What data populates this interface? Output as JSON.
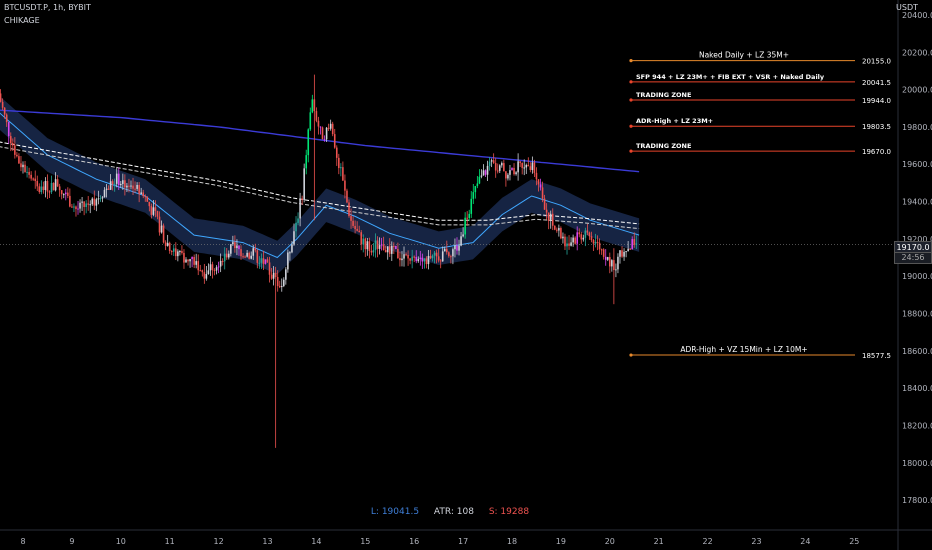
{
  "header": {
    "symbol": "BTCUSDT.P, 1h, BYBIT",
    "author": "CHIKAGE",
    "currency": "USDT"
  },
  "last_price": "19170.0",
  "countdown": "24:56",
  "stats": {
    "low_label": "L: 19041.5",
    "atr_label": "ATR: 108",
    "short_label": "S: 19288"
  },
  "colors": {
    "background": "#000000",
    "level_line": "#e8442b",
    "level_line_orange": "#e6892c",
    "sma_purple": "#3b3bd6",
    "band_fill": "#1a2a4f",
    "band_mid": "#3fa7ff",
    "bull": "#26a69a",
    "bear": "#ef5350",
    "neutral": "#d1d4dc",
    "magenta": "#d946ef",
    "green_bright": "#00e676"
  },
  "chart_data": {
    "type": "candlestick",
    "xlabels": [
      "8",
      "9",
      "10",
      "11",
      "12",
      "13",
      "14",
      "15",
      "16",
      "17",
      "18",
      "19",
      "20",
      "21",
      "22",
      "23",
      "24",
      "25"
    ],
    "y_ticks": [
      17800,
      18000,
      18200,
      18400,
      18600,
      18800,
      19000,
      19200,
      19400,
      19600,
      19800,
      20000,
      20200,
      20400
    ],
    "y_tick_labels": [
      "17800.0",
      "18000.0",
      "18200.0",
      "18400.0",
      "18600.0",
      "18800.0",
      "19000.0",
      "19200.0",
      "19400.0",
      "19600.0",
      "19800.0",
      "20000.0",
      "20200.0",
      "20400.0"
    ],
    "ylim": [
      17640,
      20480
    ],
    "xlim_days": [
      7.5,
      26.0
    ],
    "levels": [
      {
        "label": "Naked Daily + LZ 35M+",
        "value": 20155.0,
        "value_label": "20155.0",
        "color": "orange",
        "label_align": "center"
      },
      {
        "label": "SFP 944 + LZ 23M+ + FIB EXT + VSR + Naked Daily",
        "value": 20041.5,
        "value_label": "20041.5",
        "color": "red",
        "label_align": "left"
      },
      {
        "label": "TRADING ZONE",
        "value": 19944.0,
        "value_label": "19944.0",
        "color": "red",
        "label_align": "left"
      },
      {
        "label": "ADR-High + LZ 23M+",
        "value": 19803.5,
        "value_label": "19803.5",
        "color": "red",
        "label_align": "left"
      },
      {
        "label": "TRADING ZONE",
        "value": 19670.0,
        "value_label": "19670.0",
        "color": "red",
        "label_align": "left"
      },
      {
        "label": "ADR-High + VZ 15Min + LZ 10M+",
        "value": 18577.5,
        "value_label": "18577.5",
        "color": "orange",
        "label_align": "center"
      }
    ],
    "price_path": [
      [
        7.5,
        19980
      ],
      [
        7.7,
        19780
      ],
      [
        7.9,
        19620
      ],
      [
        8.1,
        19560
      ],
      [
        8.3,
        19460
      ],
      [
        8.5,
        19480
      ],
      [
        8.7,
        19500
      ],
      [
        8.9,
        19420
      ],
      [
        9.1,
        19360
      ],
      [
        9.3,
        19380
      ],
      [
        9.5,
        19420
      ],
      [
        9.7,
        19470
      ],
      [
        9.9,
        19520
      ],
      [
        10.1,
        19500
      ],
      [
        10.3,
        19470
      ],
      [
        10.5,
        19420
      ],
      [
        10.7,
        19320
      ],
      [
        10.9,
        19200
      ],
      [
        11.1,
        19120
      ],
      [
        11.3,
        19100
      ],
      [
        11.5,
        19080
      ],
      [
        11.7,
        19020
      ],
      [
        11.9,
        19060
      ],
      [
        12.1,
        19110
      ],
      [
        12.3,
        19150
      ],
      [
        12.5,
        19130
      ],
      [
        12.7,
        19120
      ],
      [
        12.9,
        19080
      ],
      [
        13.1,
        19000
      ],
      [
        13.3,
        18950
      ],
      [
        13.5,
        19200
      ],
      [
        13.7,
        19420
      ],
      [
        13.9,
        19950
      ],
      [
        14.1,
        19750
      ],
      [
        14.3,
        19800
      ],
      [
        14.5,
        19550
      ],
      [
        14.7,
        19300
      ],
      [
        14.9,
        19200
      ],
      [
        15.1,
        19150
      ],
      [
        15.3,
        19170
      ],
      [
        15.5,
        19140
      ],
      [
        15.7,
        19110
      ],
      [
        15.9,
        19090
      ],
      [
        16.1,
        19120
      ],
      [
        16.3,
        19080
      ],
      [
        16.5,
        19110
      ],
      [
        16.7,
        19130
      ],
      [
        16.9,
        19160
      ],
      [
        17.1,
        19350
      ],
      [
        17.3,
        19500
      ],
      [
        17.5,
        19580
      ],
      [
        17.7,
        19600
      ],
      [
        17.9,
        19550
      ],
      [
        18.1,
        19580
      ],
      [
        18.3,
        19620
      ],
      [
        18.5,
        19550
      ],
      [
        18.7,
        19350
      ],
      [
        18.9,
        19250
      ],
      [
        19.1,
        19180
      ],
      [
        19.3,
        19200
      ],
      [
        19.5,
        19240
      ],
      [
        19.7,
        19180
      ],
      [
        19.9,
        19120
      ],
      [
        20.1,
        19050
      ],
      [
        20.3,
        19150
      ],
      [
        20.5,
        19170
      ]
    ],
    "spikes": [
      {
        "day": 13.15,
        "low": 18080,
        "high": 19050
      },
      {
        "day": 13.95,
        "low": 19300,
        "high": 20080
      },
      {
        "day": 20.1,
        "low": 18850,
        "high": 19150
      }
    ],
    "sma_long": [
      [
        7.5,
        19890
      ],
      [
        10,
        19850
      ],
      [
        12,
        19800
      ],
      [
        13.5,
        19750
      ],
      [
        15,
        19700
      ],
      [
        17,
        19650
      ],
      [
        19,
        19600
      ],
      [
        20.6,
        19560
      ]
    ],
    "dashed_ma": [
      [
        7.5,
        19720
      ],
      [
        9,
        19650
      ],
      [
        10.5,
        19580
      ],
      [
        12,
        19510
      ],
      [
        13.5,
        19420
      ],
      [
        14.5,
        19380
      ],
      [
        15.5,
        19340
      ],
      [
        16.5,
        19300
      ],
      [
        17.5,
        19300
      ],
      [
        18.5,
        19330
      ],
      [
        19.5,
        19310
      ],
      [
        20.6,
        19280
      ]
    ],
    "band_mid": [
      [
        7.5,
        19880
      ],
      [
        8.5,
        19650
      ],
      [
        9.5,
        19520
      ],
      [
        10.5,
        19430
      ],
      [
        11.5,
        19220
      ],
      [
        12.5,
        19180
      ],
      [
        13.2,
        19100
      ],
      [
        13.6,
        19200
      ],
      [
        14.2,
        19380
      ],
      [
        14.8,
        19320
      ],
      [
        15.5,
        19230
      ],
      [
        16.5,
        19150
      ],
      [
        17.2,
        19180
      ],
      [
        17.8,
        19330
      ],
      [
        18.4,
        19430
      ],
      [
        19.0,
        19380
      ],
      [
        19.6,
        19300
      ],
      [
        20.6,
        19220
      ]
    ]
  }
}
